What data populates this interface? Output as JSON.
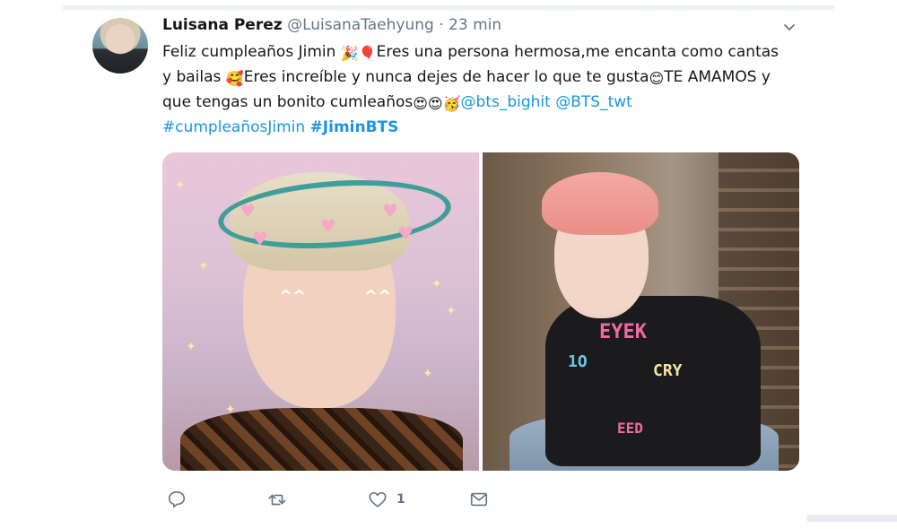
{
  "tweet": {
    "author_name": "Luisana Perez",
    "author_handle": "@LuisanaTaehyung",
    "separator": "·",
    "time": "23 min",
    "text": {
      "line1": {
        "part1": "Feliz cumpleaños Jimin ",
        "emoji1": "🎉",
        "emoji2": "🎈",
        "part2": "Eres una persona hermosa,me encanta como cantas"
      },
      "line2": {
        "part1": "y bailas ",
        "emoji1": "🥰",
        "part2": "Eres increíble y nunca dejes de hacer lo que te gusta",
        "emoji2": "😊",
        "part3": "TE AMAMOS y"
      },
      "line3": {
        "part1": "que tengas un bonito cumleaños",
        "emoji1": "😍",
        "emoji2": "😍",
        "emoji3": "🥳",
        "mention1": "@bts_bighit",
        "mention2": "@BTS_twt"
      },
      "line4": {
        "hashtag1": "#cumpleañosJimin",
        "hashtag2": "#JiminBTS"
      }
    },
    "media": {
      "left": {
        "graffiti": []
      },
      "right": {
        "graffiti": [
          "EYEK",
          "1O",
          "CRY",
          "EED"
        ]
      }
    },
    "actions": {
      "reply_icon": "reply-icon",
      "retweet_icon": "retweet-icon",
      "like_icon": "heart-icon",
      "like_count": "1",
      "dm_icon": "envelope-icon"
    }
  },
  "colors": {
    "link": "#1b95e0",
    "secondary": "#657786",
    "text": "#14171a"
  }
}
